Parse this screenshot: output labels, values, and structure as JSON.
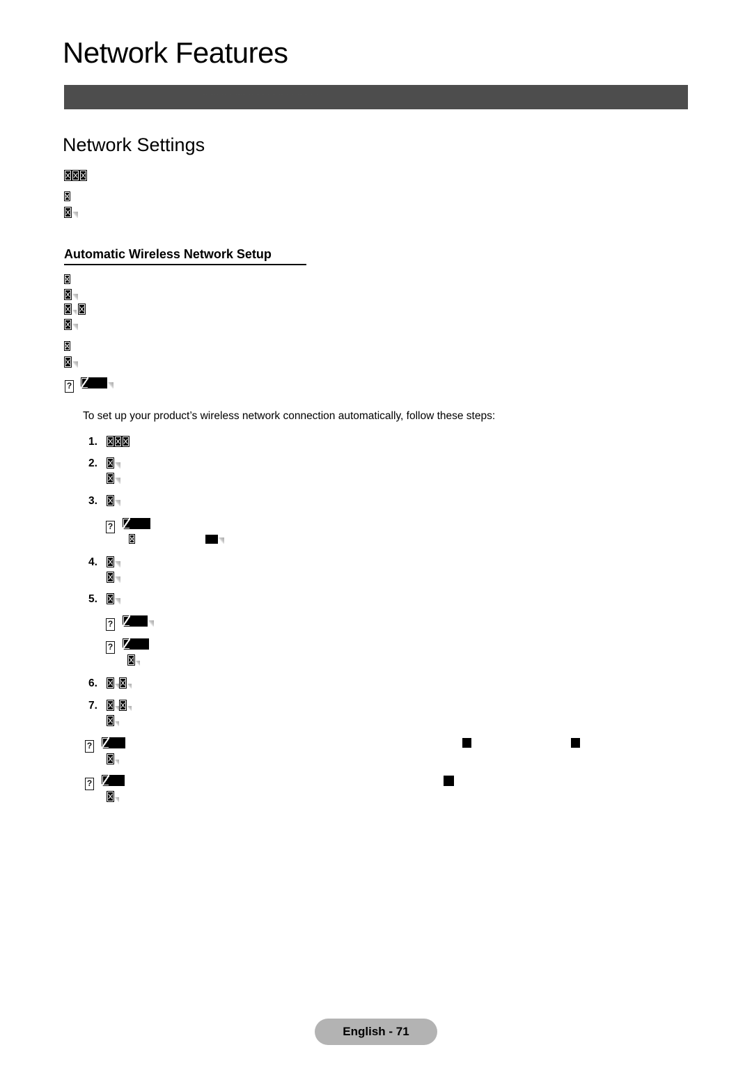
{
  "document": {
    "page_title": "Network Features",
    "banner_text": "..  ... .. . ....  .. . .  . . .. .  .  .. .   . .",
    "section_heading": "Network Settings",
    "sub_heading": "Automatic Wireless Network Setup",
    "intro_paragraph": "To set up your product’s wireless network connection automatically, follow these steps:",
    "list_numbers": [
      "1.",
      "2.",
      "3.",
      "4.",
      "5.",
      "6.",
      "7."
    ],
    "note_marker": "?",
    "footer": {
      "label": "English - 71"
    },
    "colors": {
      "banner": "#4d4d4d",
      "footer_pill": "#b3b3b3",
      "text": "#000000",
      "page_background": "#ffffff"
    }
  }
}
